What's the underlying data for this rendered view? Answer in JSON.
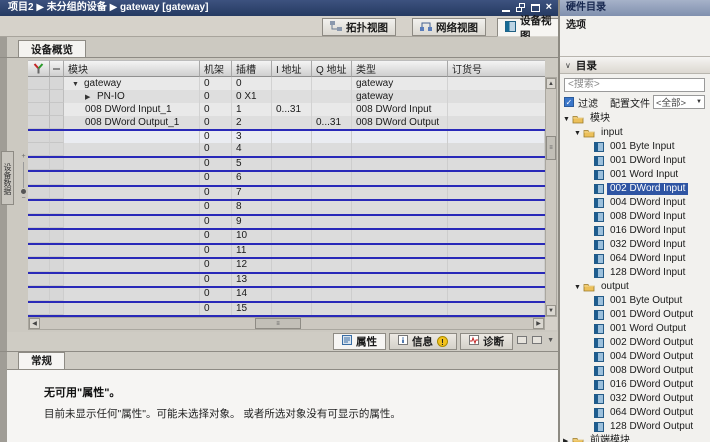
{
  "colors": {
    "selection": "#2f55a3",
    "insert_line": "#2929b8",
    "titlebar": "#2e4168",
    "checkbox": "#3a76c9"
  },
  "titlebar": {
    "breadcrumb": "项目2 ▶ 未分组的设备 ▶ gateway [gateway]"
  },
  "view_tabs": [
    {
      "label": "拓扑视图",
      "icon": "topology-icon",
      "active": false
    },
    {
      "label": "网络视图",
      "icon": "network-icon",
      "active": false
    },
    {
      "label": "设备视图",
      "icon": "device-icon",
      "active": true
    }
  ],
  "editor": {
    "overview_tab": "设备概览",
    "side_tab_label": "设备数据"
  },
  "table": {
    "columns": [
      "模块",
      "机架",
      "插槽",
      "I 地址",
      "Q 地址",
      "类型",
      "订货号"
    ],
    "rows": [
      {
        "indent": 1,
        "expander": "▼",
        "module": "gateway",
        "rack": "0",
        "slot": "0",
        "i_addr": "",
        "q_addr": "",
        "type": "gateway",
        "order_no": ""
      },
      {
        "indent": 2,
        "expander": "▶",
        "module": "PN-IO",
        "rack": "0",
        "slot": "0 X1",
        "i_addr": "",
        "q_addr": "",
        "type": "gateway",
        "order_no": ""
      },
      {
        "indent": 2,
        "expander": "",
        "module": "008 DWord Input_1",
        "rack": "0",
        "slot": "1",
        "i_addr": "0...31",
        "q_addr": "",
        "type": "008 DWord Input",
        "order_no": ""
      },
      {
        "indent": 2,
        "expander": "",
        "module": "008 DWord Output_1",
        "rack": "0",
        "slot": "2",
        "i_addr": "",
        "q_addr": "0...31",
        "type": "008 DWord Output",
        "order_no": ""
      }
    ],
    "empty_slots": [
      {
        "rack": "0",
        "slot": "3"
      },
      {
        "rack": "0",
        "slot": "4"
      },
      {
        "rack": "0",
        "slot": "5"
      },
      {
        "rack": "0",
        "slot": "6"
      },
      {
        "rack": "0",
        "slot": "7"
      },
      {
        "rack": "0",
        "slot": "8"
      },
      {
        "rack": "0",
        "slot": "9"
      },
      {
        "rack": "0",
        "slot": "10"
      },
      {
        "rack": "0",
        "slot": "11"
      },
      {
        "rack": "0",
        "slot": "12"
      },
      {
        "rack": "0",
        "slot": "13"
      },
      {
        "rack": "0",
        "slot": "14"
      },
      {
        "rack": "0",
        "slot": "15"
      }
    ]
  },
  "catalog": {
    "panel_title": "硬件目录",
    "options_label": "选项",
    "section_label": "目录",
    "search_placeholder": "<搜索>",
    "filter_label": "过滤",
    "filter_checked": "✓",
    "profile_label": "配置文件",
    "profile_value": "<全部>",
    "tree": [
      {
        "label": "模块",
        "level": 0,
        "type": "folder",
        "expanded": true
      },
      {
        "label": "input",
        "level": 1,
        "type": "folder",
        "expanded": true
      },
      {
        "label": "001 Byte Input",
        "level": 2,
        "type": "module"
      },
      {
        "label": "001 DWord Input",
        "level": 2,
        "type": "module"
      },
      {
        "label": "001 Word Input",
        "level": 2,
        "type": "module"
      },
      {
        "label": "002 DWord Input",
        "level": 2,
        "type": "module",
        "selected": true
      },
      {
        "label": "004 DWord Input",
        "level": 2,
        "type": "module"
      },
      {
        "label": "008 DWord Input",
        "level": 2,
        "type": "module"
      },
      {
        "label": "016 DWord Input",
        "level": 2,
        "type": "module"
      },
      {
        "label": "032 DWord Input",
        "level": 2,
        "type": "module"
      },
      {
        "label": "064 DWord Input",
        "level": 2,
        "type": "module"
      },
      {
        "label": "128 DWord Input",
        "level": 2,
        "type": "module"
      },
      {
        "label": "output",
        "level": 1,
        "type": "folder",
        "expanded": true
      },
      {
        "label": "001 Byte Output",
        "level": 2,
        "type": "module"
      },
      {
        "label": "001 DWord Output",
        "level": 2,
        "type": "module"
      },
      {
        "label": "001 Word Output",
        "level": 2,
        "type": "module"
      },
      {
        "label": "002 DWord Output",
        "level": 2,
        "type": "module"
      },
      {
        "label": "004 DWord Output",
        "level": 2,
        "type": "module"
      },
      {
        "label": "008 DWord Output",
        "level": 2,
        "type": "module"
      },
      {
        "label": "016 DWord Output",
        "level": 2,
        "type": "module"
      },
      {
        "label": "032 DWord Output",
        "level": 2,
        "type": "module"
      },
      {
        "label": "064 DWord Output",
        "level": 2,
        "type": "module"
      },
      {
        "label": "128 DWord Output",
        "level": 2,
        "type": "module"
      },
      {
        "label": "前端模块",
        "level": 0,
        "type": "folder",
        "expanded": false
      }
    ]
  },
  "inspector": {
    "tabs": [
      {
        "label": "属性",
        "icon": "properties-icon",
        "active": true
      },
      {
        "label": "信息",
        "icon": "info-icon",
        "badge": "!",
        "active": false
      },
      {
        "label": "诊断",
        "icon": "diagnostics-icon",
        "active": false
      }
    ],
    "general_tab": "常规",
    "message_title": "无可用\"属性\"。",
    "message_body": "目前未显示任何\"属性\"。可能未选择对象。 或者所选对象没有可显示的属性。"
  }
}
